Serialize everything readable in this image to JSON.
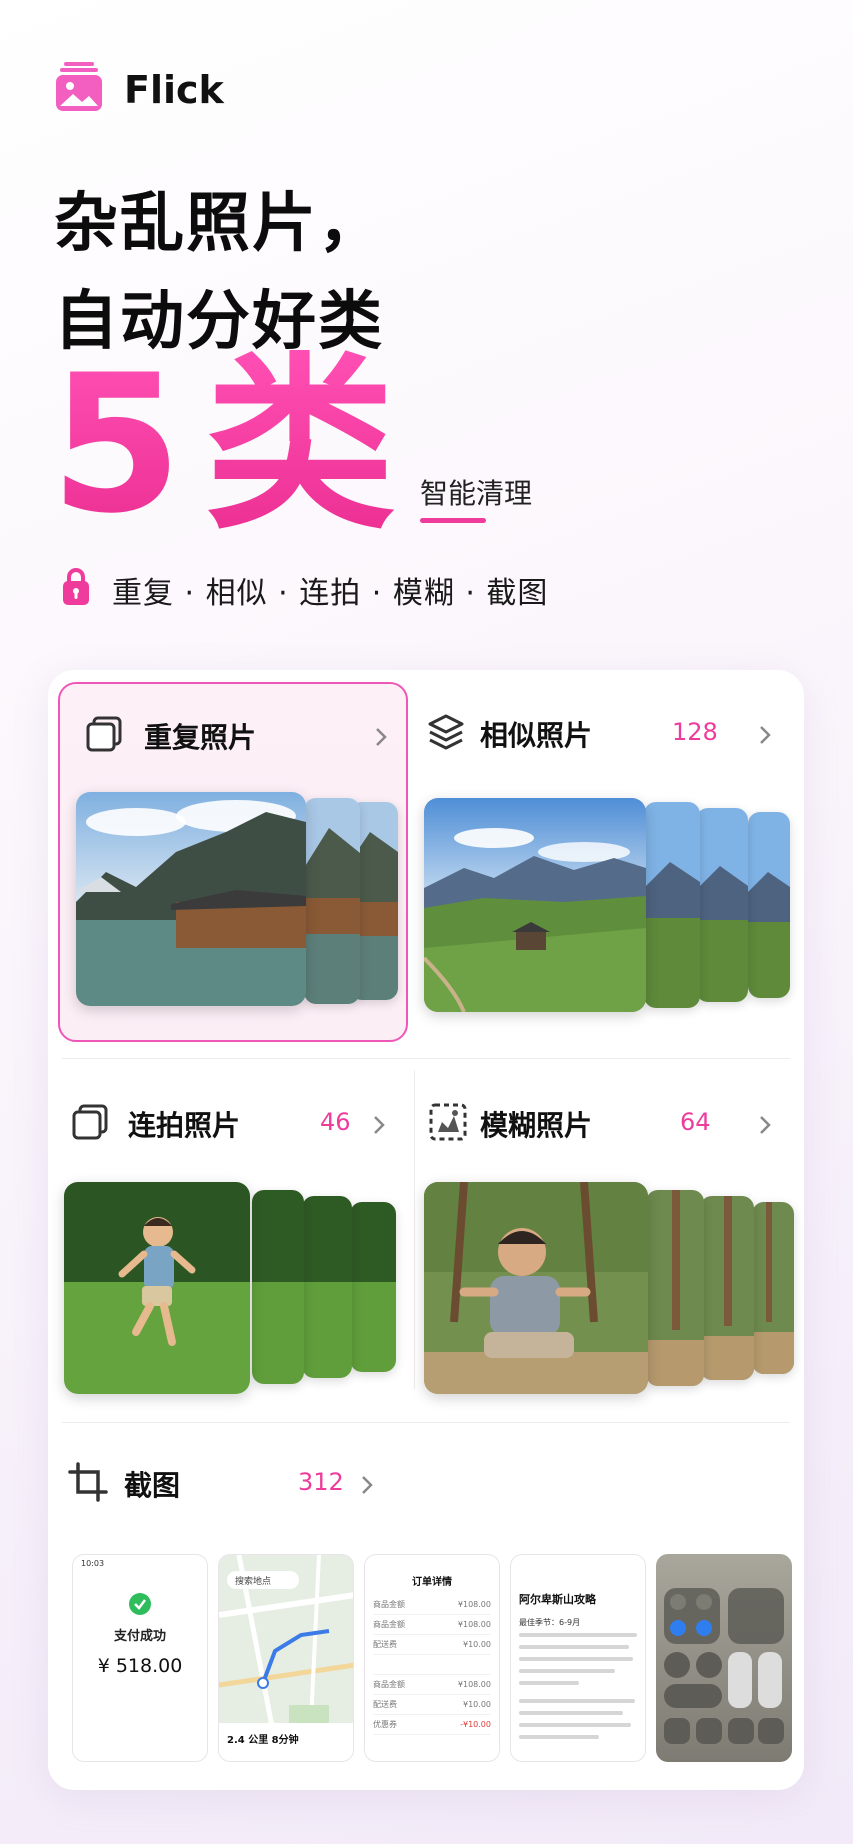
{
  "brand": {
    "name": "Flick"
  },
  "headline": {
    "line1": "杂乱照片，",
    "line2": "自动分好类"
  },
  "hero": {
    "number": "5",
    "unit": "类",
    "tagline": "智能清理"
  },
  "categories_line": "重复 · 相似 · 连拍 · 模糊 · 截图",
  "cards": {
    "duplicate": {
      "title": "重复照片",
      "count": ""
    },
    "similar": {
      "title": "相似照片",
      "count": "128"
    },
    "burst": {
      "title": "连拍照片",
      "count": "46"
    },
    "blur": {
      "title": "模糊照片",
      "count": "64"
    },
    "screenshot": {
      "title": "截图",
      "count": "312"
    }
  },
  "screenshots": {
    "pay": {
      "status": "支付成功",
      "amount": "¥ 518.00"
    },
    "map": {
      "search": "搜索地点",
      "distance": "2.4 公里 8分钟"
    },
    "order": {
      "title": "订单详情",
      "rows": [
        {
          "label": "商品金额",
          "value": "¥108.00"
        },
        {
          "label": "商品金额",
          "value": "¥108.00"
        },
        {
          "label": "配送费",
          "value": "¥10.00"
        },
        {
          "label": "",
          "value": ""
        },
        {
          "label": "商品金额",
          "value": "¥108.00"
        },
        {
          "label": "配送费",
          "value": "¥10.00"
        },
        {
          "label": "优惠券",
          "value": "-¥10.00"
        }
      ]
    },
    "guide": {
      "title": "阿尔卑斯山攻略",
      "season": "最佳季节：6-9月"
    }
  },
  "colors": {
    "accent": "#ee3c9c",
    "selected_border": "#ee57b8"
  }
}
